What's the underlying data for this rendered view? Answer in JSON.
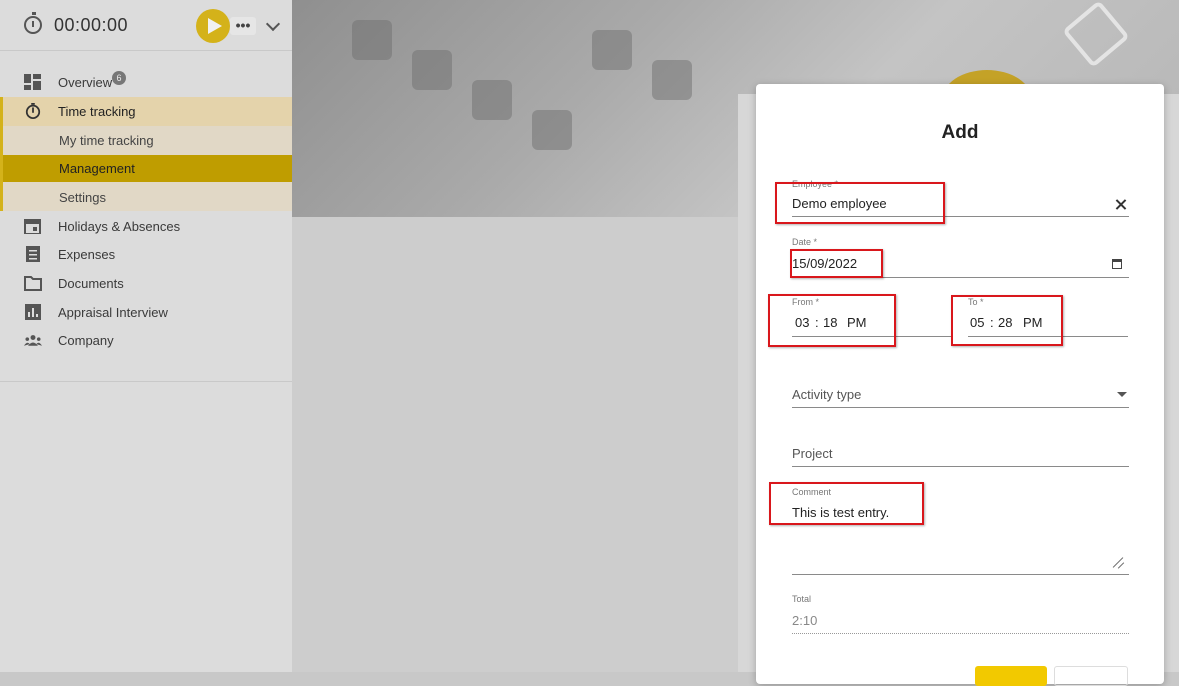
{
  "timer": {
    "value": "00:00:00",
    "more_label": "•••"
  },
  "nav": {
    "overview": {
      "label": "Overview",
      "badge": "6"
    },
    "time_tracking": {
      "label": "Time tracking"
    },
    "my_time_tracking": {
      "label": "My time tracking"
    },
    "management": {
      "label": "Management"
    },
    "settings": {
      "label": "Settings"
    },
    "holidays": {
      "label": "Holidays & Absences"
    },
    "expenses": {
      "label": "Expenses"
    },
    "documents": {
      "label": "Documents"
    },
    "appraisal": {
      "label": "Appraisal Interview"
    },
    "company": {
      "label": "Company"
    }
  },
  "dialog": {
    "title": "Add",
    "employee": {
      "label": "Employee *",
      "value": "Demo employee"
    },
    "date": {
      "label": "Date *",
      "value": "15/09/2022"
    },
    "from": {
      "label": "From *",
      "hh": "03",
      "mm": "18",
      "ampm": "PM"
    },
    "to": {
      "label": "To *",
      "hh": "05",
      "mm": "28",
      "ampm": "PM"
    },
    "activity_type": {
      "placeholder": "Activity type"
    },
    "project": {
      "placeholder": "Project"
    },
    "comment": {
      "label": "Comment",
      "value": "This is test entry."
    },
    "total": {
      "label": "Total",
      "value": "2:10"
    }
  },
  "colors": {
    "accent": "#f2c900",
    "highlight_box": "#d9171c"
  }
}
